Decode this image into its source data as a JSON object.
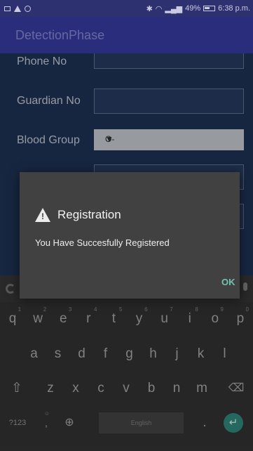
{
  "status_bar": {
    "battery": "49%",
    "time": "6:38 p.m."
  },
  "app_bar": {
    "title": "DetectionPhase"
  },
  "form": {
    "phone_label": "Phone No",
    "guardian_label": "Guardian No",
    "blood_group_label": "Blood Group",
    "blood_group_value": "O-"
  },
  "dialog": {
    "title": "Registration",
    "message": "You Have Succesfully Registered",
    "ok_label": "OK"
  },
  "keyboard": {
    "row1": [
      {
        "k": "q",
        "h": "1"
      },
      {
        "k": "w",
        "h": "2"
      },
      {
        "k": "e",
        "h": "3"
      },
      {
        "k": "r",
        "h": "4"
      },
      {
        "k": "t",
        "h": "5"
      },
      {
        "k": "y",
        "h": "6"
      },
      {
        "k": "u",
        "h": "7"
      },
      {
        "k": "i",
        "h": "8"
      },
      {
        "k": "o",
        "h": "9"
      },
      {
        "k": "p",
        "h": "0"
      }
    ],
    "row2": [
      "a",
      "s",
      "d",
      "f",
      "g",
      "h",
      "j",
      "k",
      "l"
    ],
    "row3": [
      "z",
      "x",
      "c",
      "v",
      "b",
      "n",
      "m"
    ],
    "symbols_label": "?123",
    "comma_label": ",",
    "space_label": "English",
    "period_label": "."
  },
  "icons": {
    "shift": "shift-icon",
    "backspace": "backspace-icon",
    "globe": "globe-icon",
    "enter": "enter-icon",
    "emoji": "emoji-icon",
    "mic": "mic-icon",
    "google": "google-icon"
  }
}
